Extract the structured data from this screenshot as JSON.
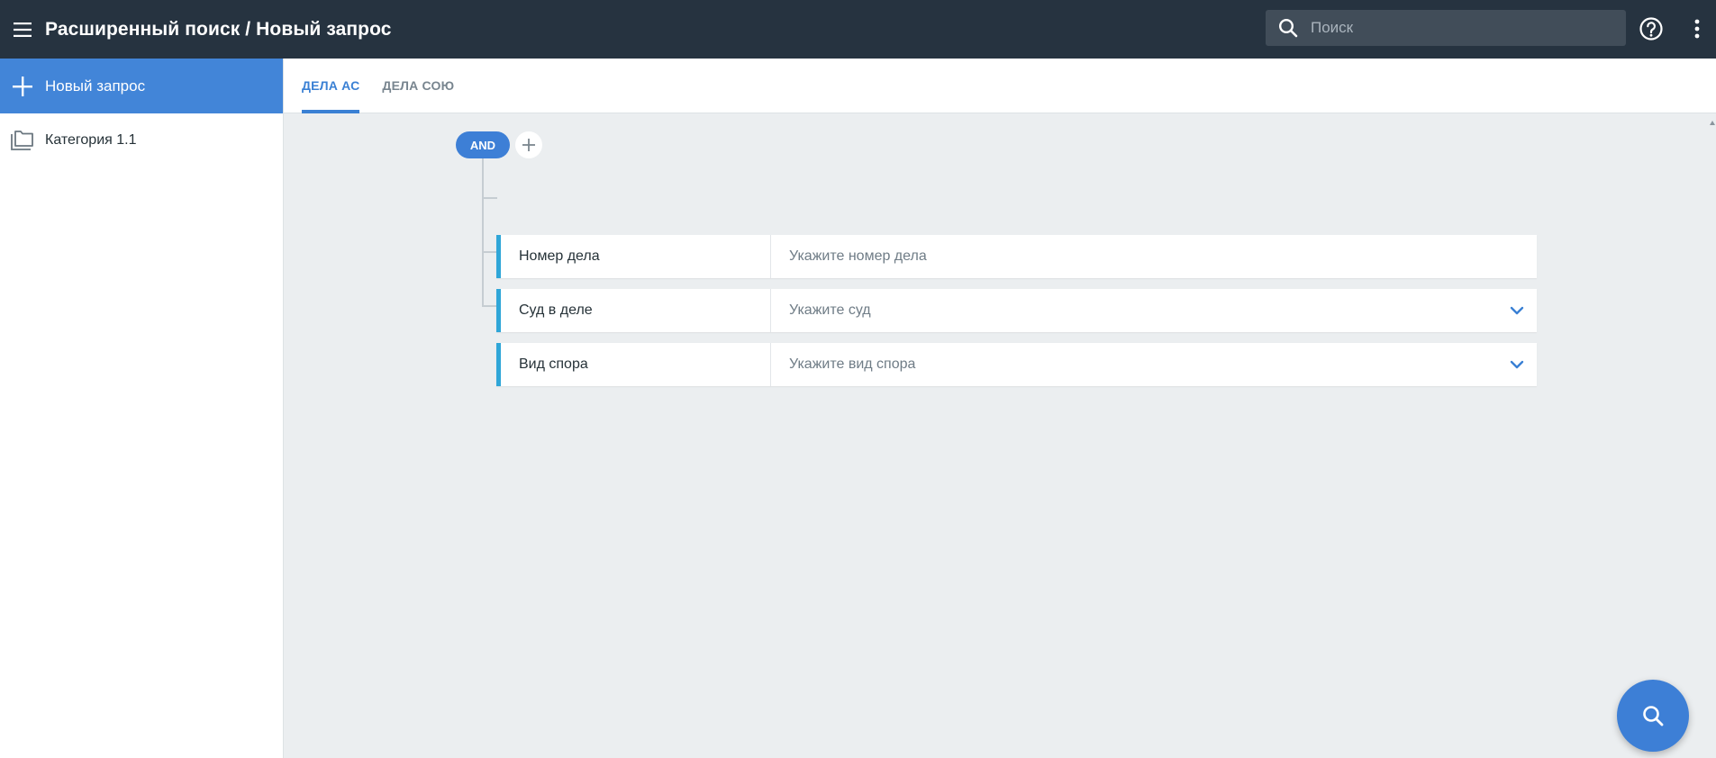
{
  "header": {
    "title": "Расширенный поиск / Новый запрос",
    "search_placeholder": "Поиск",
    "help_icon": "help-circle-icon",
    "more_icon": "more-vertical-icon",
    "menu_icon": "hamburger-menu-icon"
  },
  "sidebar": {
    "new_query_label": "Новый запрос",
    "items": [
      {
        "label": "Категория 1.1",
        "icon": "folder-icon"
      }
    ]
  },
  "tabs": [
    {
      "label": "ДЕЛА АС",
      "active": true
    },
    {
      "label": "ДЕЛА СОЮ",
      "active": false
    }
  ],
  "builder": {
    "operator": "AND",
    "rules": [
      {
        "field": "Номер дела",
        "placeholder": "Укажите номер дела",
        "type": "text"
      },
      {
        "field": "Суд в деле",
        "placeholder": "Укажите суд",
        "type": "select"
      },
      {
        "field": "Вид спора",
        "placeholder": "Укажите вид спора",
        "type": "select"
      }
    ]
  },
  "colors": {
    "topbar": "#263340",
    "accent": "#3d7fd6",
    "rule_border": "#2fa6d8",
    "background": "#ebeef0"
  }
}
